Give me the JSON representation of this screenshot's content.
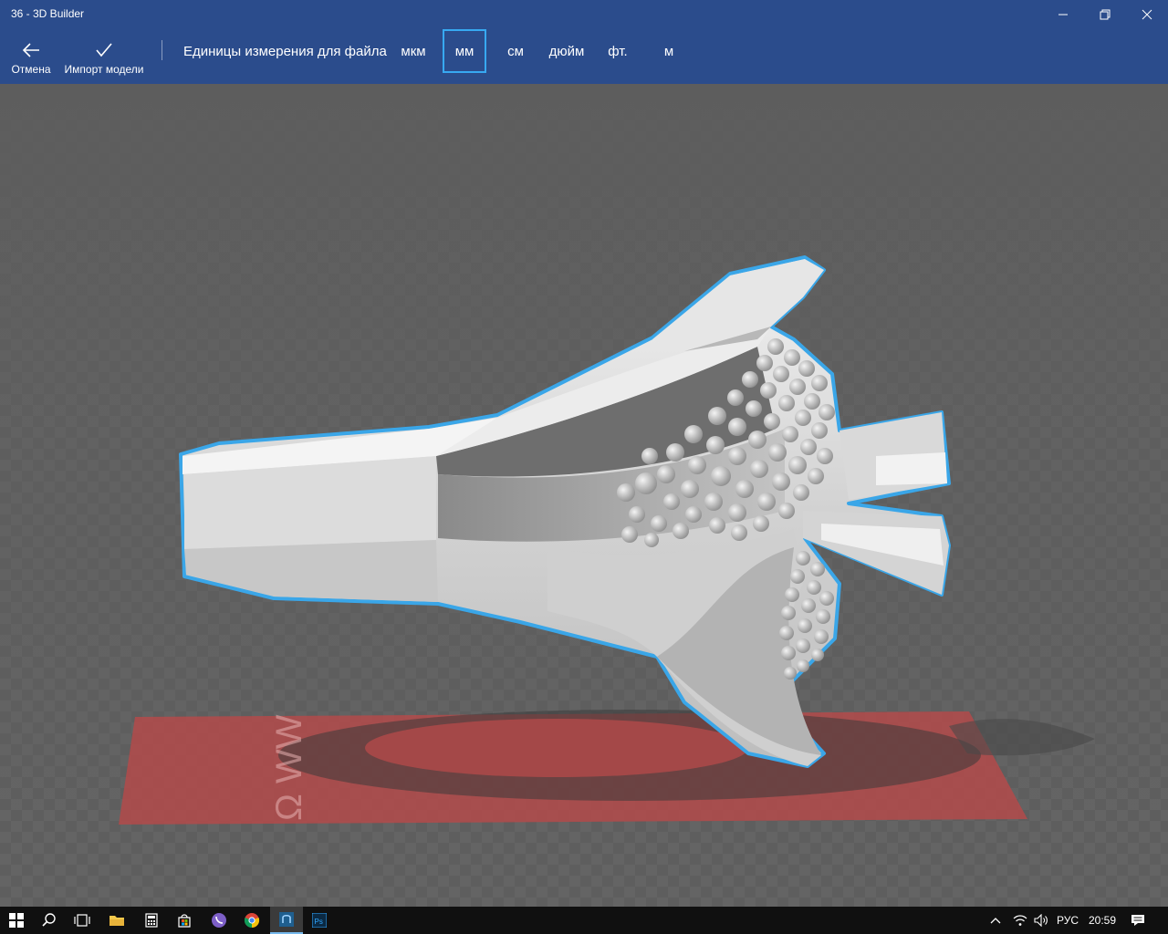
{
  "window": {
    "title": "36 - 3D Builder"
  },
  "toolbar": {
    "cancel_label": "Отмена",
    "import_label": "Импорт модели",
    "units_label": "Единицы измерения для файла",
    "units": [
      "мкм",
      "мм",
      "см",
      "дюйм",
      "фт.",
      "м"
    ],
    "selected_unit": "мм"
  },
  "scene": {
    "plate_text": "Ω WW",
    "selection_color": "#3aa6e8",
    "plate_color": "#b34a4a"
  },
  "taskbar": {
    "language": "РУС",
    "time": "20:59",
    "icons": [
      "start-icon",
      "search-icon",
      "task-view-icon",
      "file-explorer-icon",
      "calculator-icon",
      "store-icon",
      "viber-icon",
      "chrome-icon",
      "3d-builder-icon",
      "photoshop-icon"
    ]
  },
  "colors": {
    "titlebar": "#2b4c8c",
    "accent": "#37a9f2"
  }
}
